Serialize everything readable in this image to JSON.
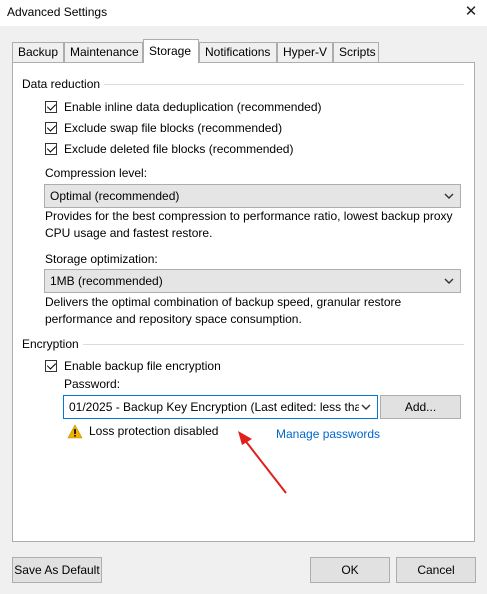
{
  "window": {
    "title": "Advanced Settings",
    "close_glyph": "✕"
  },
  "tabs": [
    "Backup",
    "Maintenance",
    "Storage",
    "Notifications",
    "Hyper-V",
    "Scripts"
  ],
  "active_tab": "Storage",
  "data_reduction": {
    "heading": "Data reduction",
    "checkboxes": [
      {
        "label": "Enable inline data deduplication (recommended)",
        "checked": true
      },
      {
        "label": "Exclude swap file blocks (recommended)",
        "checked": true
      },
      {
        "label": "Exclude deleted file blocks (recommended)",
        "checked": true
      }
    ],
    "compression": {
      "label": "Compression level:",
      "value": "Optimal (recommended)",
      "description": "Provides for the best compression to performance ratio, lowest backup proxy CPU usage and fastest restore."
    },
    "storage_optimization": {
      "label": "Storage optimization:",
      "value": "1MB (recommended)",
      "description": "Delivers the optimal combination of backup speed, granular restore performance and repository space consumption."
    }
  },
  "encryption": {
    "heading": "Encryption",
    "checkbox": {
      "label": "Enable backup file encryption",
      "checked": true
    },
    "password_label": "Password:",
    "password_value": "01/2025 - Backup Key Encryption (Last edited: less tha",
    "add_button": "Add...",
    "warning_text": "Loss protection disabled",
    "manage_link": "Manage passwords"
  },
  "footer": {
    "save_default": "Save As Default",
    "ok": "OK",
    "cancel": "Cancel"
  },
  "colors": {
    "link": "#0066cc",
    "arrow": "#e0201a",
    "warning": "#f2b100"
  },
  "icons": {
    "warning": "warning-icon",
    "close": "close-icon",
    "dropdown": "chevron-down-icon"
  }
}
